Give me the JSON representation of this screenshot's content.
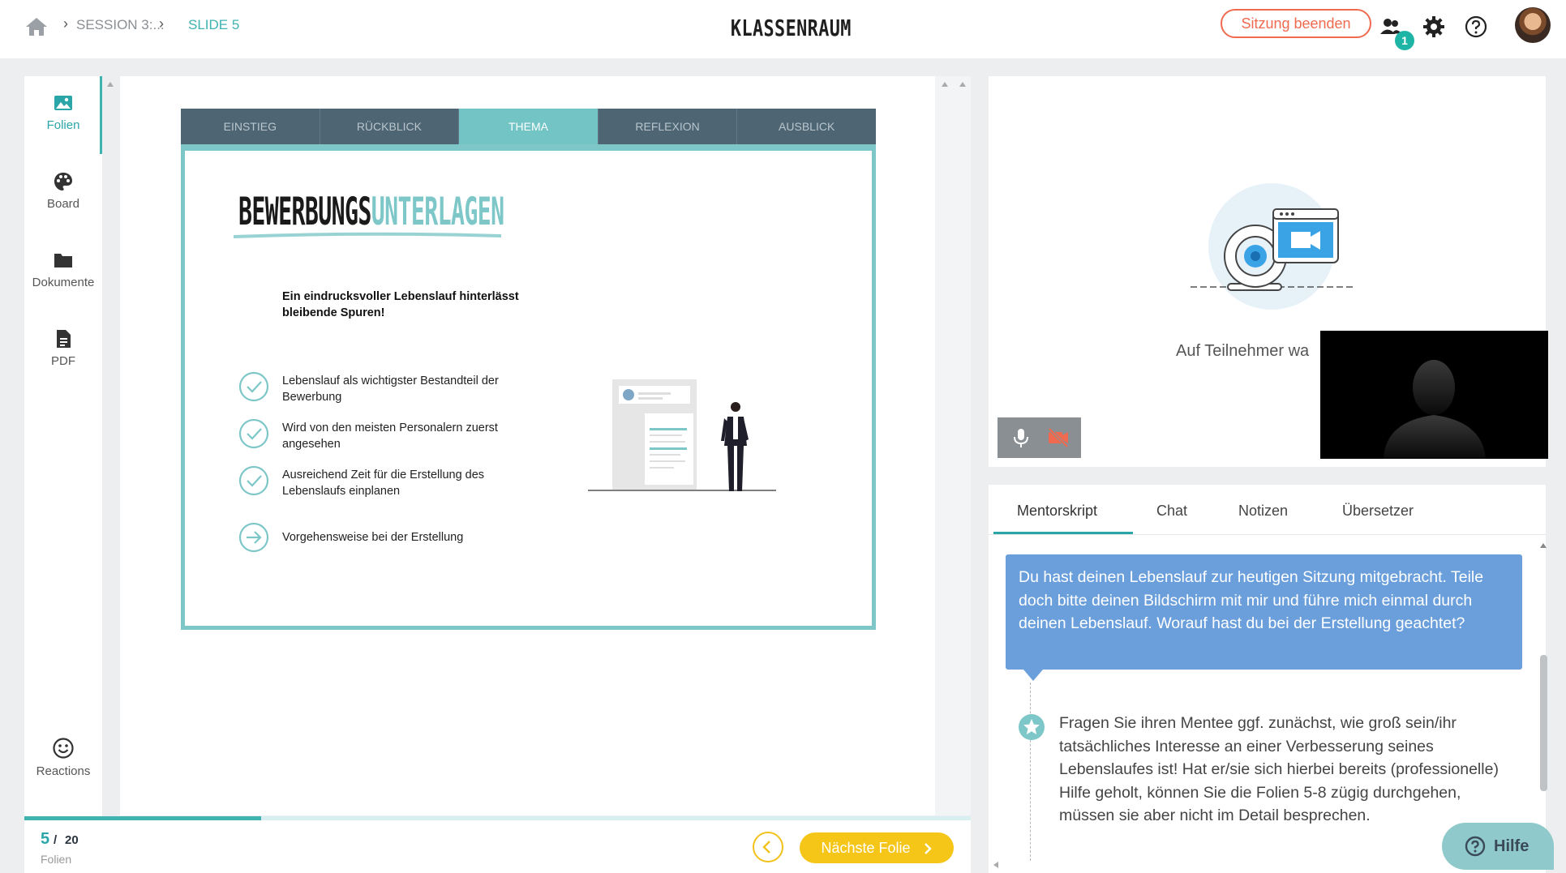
{
  "header": {
    "breadcrumb": {
      "session": "SESSION 3:...",
      "slide": "SLIDE 5"
    },
    "title": "KLASSENRAUM",
    "end_session_label": "Sitzung beenden",
    "participants_count": "1"
  },
  "sidebar": {
    "items": [
      {
        "label": "Folien",
        "icon": "image-icon",
        "active": true
      },
      {
        "label": "Board",
        "icon": "palette-icon"
      },
      {
        "label": "Dokumente",
        "icon": "folder-icon"
      },
      {
        "label": "PDF",
        "icon": "file-icon"
      }
    ],
    "reactions_label": "Reactions"
  },
  "slide": {
    "tabs": [
      {
        "label": "EINSTIEG"
      },
      {
        "label": "RÜCKBLICK"
      },
      {
        "label": "THEMA",
        "active": true
      },
      {
        "label": "REFLEXION"
      },
      {
        "label": "AUSBLICK"
      }
    ],
    "title_main": "BEWERBUNGS",
    "title_accent": "UNTERLAGEN",
    "lead": "Ein eindrucksvoller Lebenslauf hinterlässt bleibende Spuren!",
    "bullets": [
      {
        "text": "Lebenslauf als wichtigster Bestandteil der Bewerbung",
        "icon": "check-circle-icon"
      },
      {
        "text": "Wird von den meisten Personalern zuerst angesehen",
        "icon": "check-circle-icon"
      },
      {
        "text": "Ausreichend Zeit für die Erstellung des Lebenslaufs einplanen",
        "icon": "check-circle-icon"
      },
      {
        "text": "Vorgehensweise bei der Erstellung",
        "icon": "arrow-circle-icon"
      }
    ]
  },
  "pagination": {
    "current": "5",
    "separator": "/",
    "total": "20",
    "label": "Folien",
    "progress": 0.25
  },
  "footer": {
    "next_label": "Nächste Folie"
  },
  "video": {
    "waiting_text": "Auf Teilnehmer wa"
  },
  "script": {
    "tabs": [
      {
        "label": "Mentorskript",
        "active": true
      },
      {
        "label": "Chat"
      },
      {
        "label": "Notizen"
      },
      {
        "label": "Übersetzer"
      }
    ],
    "bubble_text": "Du hast deinen Lebenslauf zur heutigen Sitzung mitgebracht. Teile doch bitte deinen Bildschirm mit mir und führe mich einmal durch deinen Lebenslauf. Worauf hast du bei der Erstellung geachtet?",
    "note_text": "Fragen Sie ihren Mentee ggf. zunächst, wie groß sein/ihr tatsächliches Interesse an einer Verbesserung seines Lebenslaufes ist! Hat er/sie sich hierbei bereits (professionelle) Hilfe geholt, können Sie die Folien 5-8 zügig durchgehen, müssen sie aber nicht im Detail besprechen."
  },
  "help_label": "Hilfe",
  "colors": {
    "accent_teal": "#3fb3b0",
    "slide_teal": "#7ec7c8",
    "end_session": "#f06a4f",
    "next_button": "#f5c518",
    "bubble": "#6a9fdc",
    "tab_bar": "#4e6573"
  }
}
